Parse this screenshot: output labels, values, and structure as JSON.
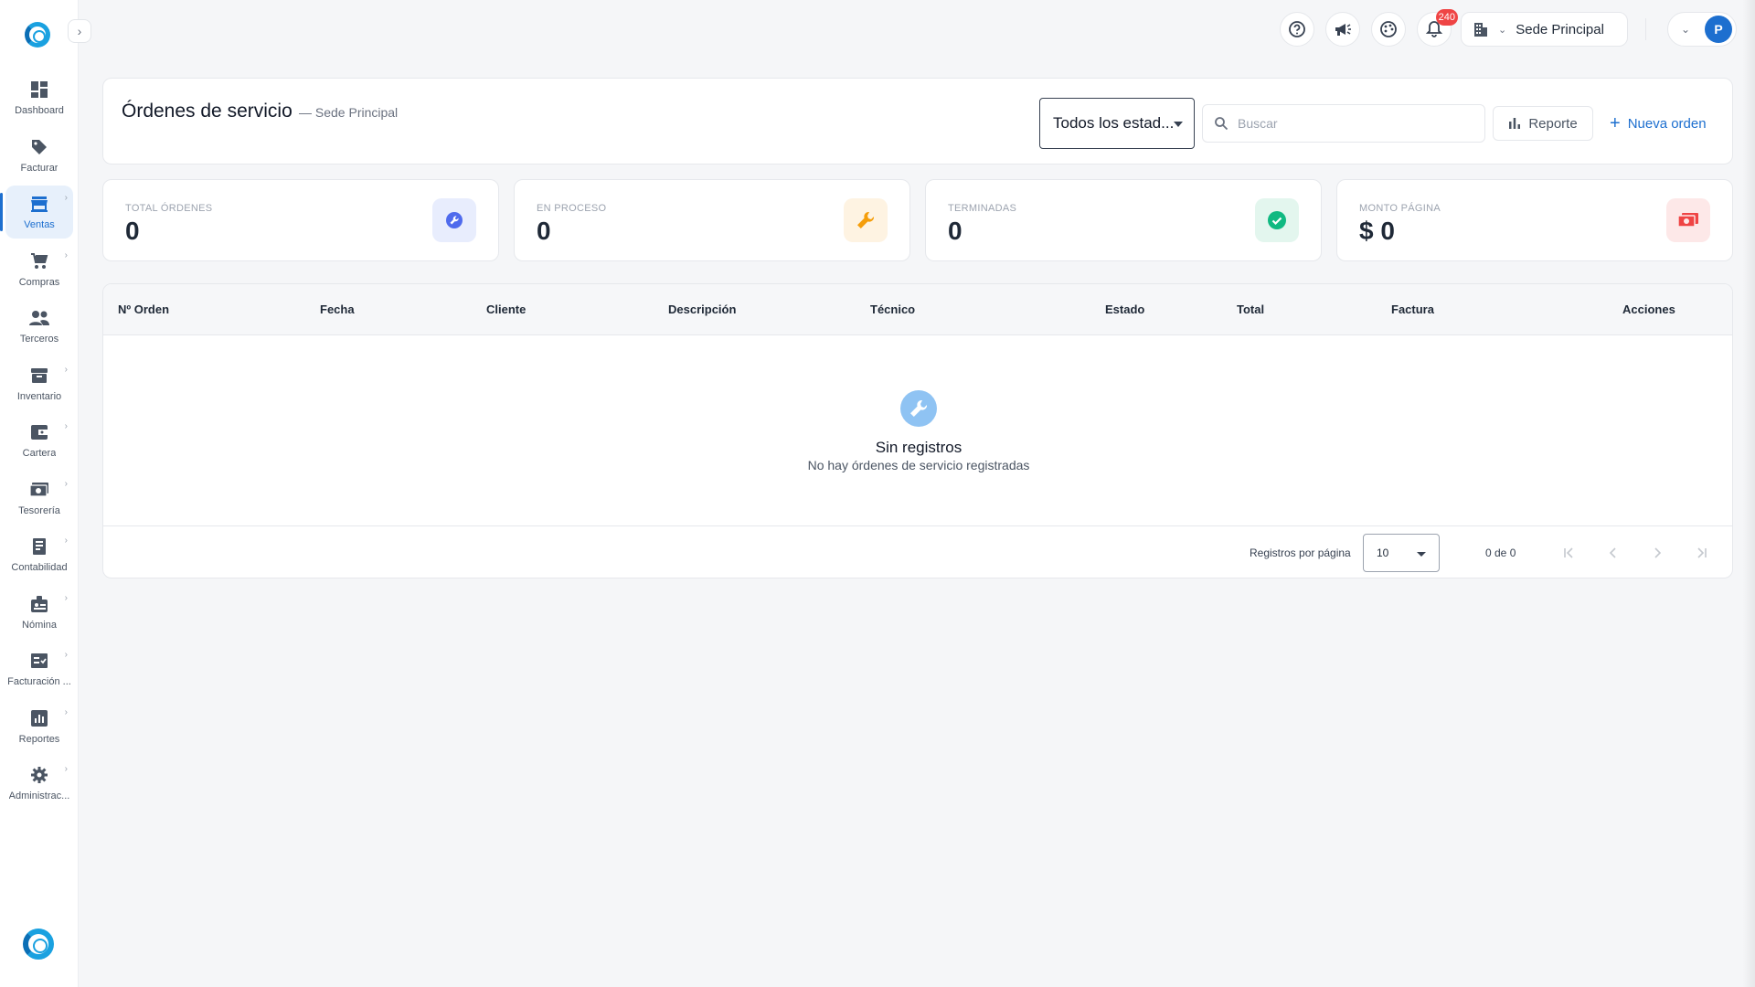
{
  "sidebar": {
    "items": [
      {
        "label": "Dashboard",
        "icon": "dashboard-icon",
        "active": false,
        "has_submenu": false
      },
      {
        "label": "Facturar",
        "icon": "tag-icon",
        "active": false,
        "has_submenu": false
      },
      {
        "label": "Ventas",
        "icon": "store-icon",
        "active": true,
        "has_submenu": true
      },
      {
        "label": "Compras",
        "icon": "cart-icon",
        "active": false,
        "has_submenu": true
      },
      {
        "label": "Terceros",
        "icon": "people-icon",
        "active": false,
        "has_submenu": false
      },
      {
        "label": "Inventario",
        "icon": "archive-icon",
        "active": false,
        "has_submenu": true
      },
      {
        "label": "Cartera",
        "icon": "wallet-icon",
        "active": false,
        "has_submenu": true
      },
      {
        "label": "Tesorería",
        "icon": "money-icon",
        "active": false,
        "has_submenu": true
      },
      {
        "label": "Contabilidad",
        "icon": "ledger-icon",
        "active": false,
        "has_submenu": true
      },
      {
        "label": "Nómina",
        "icon": "badge-icon",
        "active": false,
        "has_submenu": true
      },
      {
        "label": "Facturación ...",
        "icon": "invoice-check-icon",
        "active": false,
        "has_submenu": true
      },
      {
        "label": "Reportes",
        "icon": "chart-icon",
        "active": false,
        "has_submenu": true
      },
      {
        "label": "Administrac...",
        "icon": "gear-icon",
        "active": false,
        "has_submenu": true
      }
    ]
  },
  "topbar": {
    "notifications_count": "240",
    "sede_label": "Sede Principal",
    "avatar_initial": "P"
  },
  "header": {
    "title": "Órdenes de servicio",
    "subtitle": "— Sede Principal",
    "status_filter": "Todos los estad...",
    "search_placeholder": "Buscar",
    "report_label": "Reporte",
    "new_order_label": "Nueva orden"
  },
  "stats": [
    {
      "label": "TOTAL ÓRDENES",
      "value": "0",
      "icon": "wrench-circle-icon",
      "color": "#4f6bed",
      "bg": "#e8edfd"
    },
    {
      "label": "EN PROCESO",
      "value": "0",
      "icon": "wrench-icon",
      "color": "#f59e0b",
      "bg": "#fef3e2"
    },
    {
      "label": "TERMINADAS",
      "value": "0",
      "icon": "check-circle-icon",
      "color": "#10b981",
      "bg": "#e3f6ee"
    },
    {
      "label": "MONTO PÁGINA",
      "value": "$ 0",
      "icon": "money-icon",
      "color": "#ef4444",
      "bg": "#fde8e8"
    }
  ],
  "table": {
    "columns": [
      "Nº Orden",
      "Fecha",
      "Cliente",
      "Descripción",
      "Técnico",
      "Estado",
      "Total",
      "Factura",
      "Acciones"
    ],
    "rows": [],
    "empty_title": "Sin registros",
    "empty_subtitle": "No hay órdenes de servicio registradas",
    "rows_per_page_label": "Registros por página",
    "rows_per_page": "10",
    "range_label": "0 de 0"
  },
  "colors": {
    "accent": "#1d6fcf",
    "background": "#f5f6f8"
  }
}
